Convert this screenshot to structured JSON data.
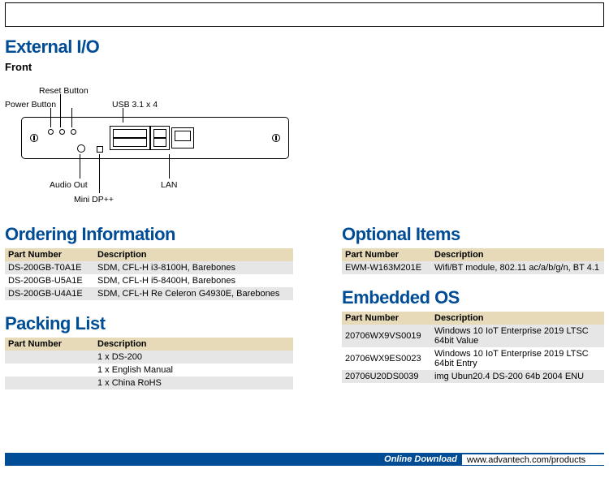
{
  "headings": {
    "external_io": "External I/O",
    "front": "Front",
    "ordering_info": "Ordering Information",
    "packing_list": "Packing List",
    "optional_items": "Optional Items",
    "embedded_os": "Embedded OS"
  },
  "diagram_labels": {
    "power_button": "Power Button",
    "reset_button": "Reset Button",
    "usb": "USB 3.1 x 4",
    "audio_out": "Audio Out",
    "mini_dp": "Mini DP++",
    "lan": "LAN"
  },
  "table_headers": {
    "part_number": "Part Number",
    "description": "Description"
  },
  "ordering": [
    {
      "pn": "DS-200GB-T0A1E",
      "desc": "SDM, CFL-H i3-8100H, Barebones"
    },
    {
      "pn": "DS-200GB-U5A1E",
      "desc": "SDM, CFL-H i5-8400H, Barebones"
    },
    {
      "pn": "DS-200GB-U4A1E",
      "desc": "SDM, CFL-H Re Celeron G4930E, Barebones"
    }
  ],
  "packing": [
    {
      "pn": "",
      "desc": "1 x DS-200"
    },
    {
      "pn": "",
      "desc": "1 x English Manual"
    },
    {
      "pn": "",
      "desc": "1 x China RoHS"
    }
  ],
  "optional": [
    {
      "pn": "EWM-W163M201E",
      "desc": "Wifi/BT module, 802.11 ac/a/b/g/n, BT 4.1"
    }
  ],
  "embedded_os": [
    {
      "pn": "20706WX9VS0019",
      "desc": "Windows 10 IoT Enterprise 2019 LTSC 64bit Value"
    },
    {
      "pn": "20706WX9ES0023",
      "desc": "Windows 10 IoT Enterprise 2019 LTSC 64bit Entry"
    },
    {
      "pn": "20706U20DS0039",
      "desc": "img Ubun20.4 DS-200 64b 2004 ENU"
    }
  ],
  "footer": {
    "label": "Online Download",
    "url": "www.advantech.com/products"
  }
}
